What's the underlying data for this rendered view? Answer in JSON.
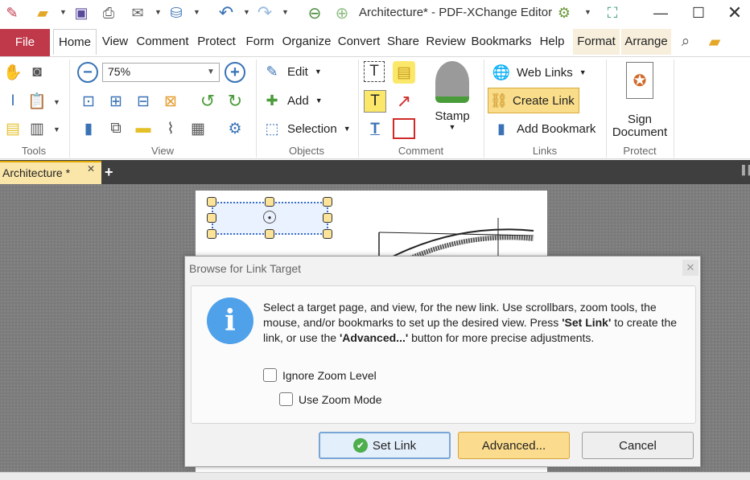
{
  "window": {
    "title": "Architecture* - PDF-XChange Editor"
  },
  "ribbon_tabs": [
    "File",
    "Home",
    "View",
    "Comment",
    "Protect",
    "Form",
    "Organize",
    "Convert",
    "Share",
    "Review",
    "Bookmarks",
    "Help",
    "Format",
    "Arrange"
  ],
  "ribbon": {
    "zoom_value": "75%",
    "objects": {
      "edit": "Edit",
      "add": "Add",
      "selection": "Selection"
    },
    "comment": {
      "stamp": "Stamp"
    },
    "links": {
      "web_links": "Web Links",
      "create_link": "Create Link",
      "add_bookmark": "Add Bookmark"
    },
    "protect": {
      "sign_line1": "Sign",
      "sign_line2": "Document"
    },
    "groups": {
      "tools": "Tools",
      "view": "View",
      "objects": "Objects",
      "comment": "Comment",
      "links": "Links",
      "protect": "Protect"
    }
  },
  "doc_tab": {
    "label": "Architecture *"
  },
  "dialog": {
    "title": "Browse for Link Target",
    "message_html_parts": {
      "p1": "Select a target page, and view, for the new link. Use scrollbars, zoom tools, the mouse, and/or bookmarks to set up the desired view. Press ",
      "b1": "'Set Link'",
      "p2": " to create the link, or use the ",
      "b2": "'Advanced...'",
      "p3": " button for more precise adjustments."
    },
    "ignore_zoom": "Ignore Zoom Level",
    "use_zoom_mode": "Use Zoom Mode",
    "set_link": "Set Link",
    "advanced": "Advanced...",
    "cancel": "Cancel"
  },
  "colors": {
    "file_tab": "#c0394b",
    "accent_yellow": "#f9dd8a",
    "info_blue": "#4fa1ea"
  }
}
